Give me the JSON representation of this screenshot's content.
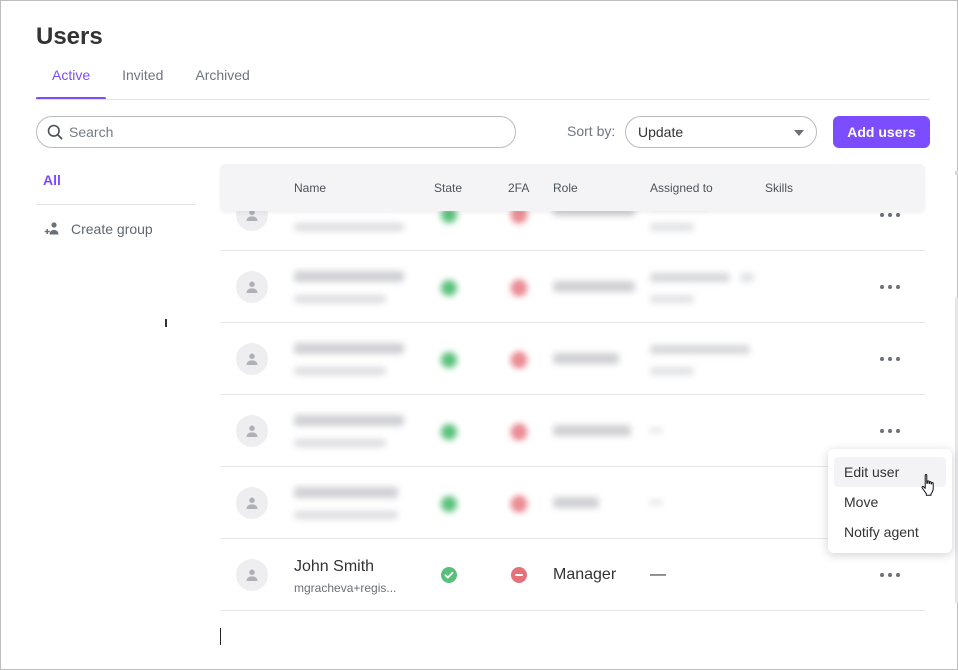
{
  "page": {
    "title": "Users"
  },
  "tabs": [
    {
      "label": "Active",
      "active": true
    },
    {
      "label": "Invited",
      "active": false
    },
    {
      "label": "Archived",
      "active": false
    }
  ],
  "toolbar": {
    "search_placeholder": "Search",
    "sort_label": "Sort by:",
    "sort_value": "Update",
    "add_label": "Add users"
  },
  "sidebar": {
    "all_label": "All",
    "create_group_label": "Create group"
  },
  "table": {
    "columns": [
      "Name",
      "State",
      "2FA",
      "Role",
      "Assigned to",
      "Skills"
    ],
    "rows": [
      {
        "name": "",
        "email": "",
        "role": "",
        "assigned": "",
        "blurred": true
      },
      {
        "name": "",
        "email": "",
        "role": "",
        "assigned": "",
        "blurred": true
      },
      {
        "name": "",
        "email": "",
        "role": "",
        "assigned": "",
        "blurred": true
      },
      {
        "name": "",
        "email": "",
        "role": "",
        "assigned": "",
        "blurred": true
      },
      {
        "name": "",
        "email": "",
        "role": "",
        "assigned": "",
        "blurred": true
      },
      {
        "name": "John Smith",
        "email": "mgracheva+regis...",
        "role": "Manager",
        "assigned": "—",
        "blurred": false
      }
    ]
  },
  "context_menu": {
    "items": [
      "Edit user",
      "Move",
      "Notify agent"
    ]
  },
  "colors": {
    "accent": "#7c4dff",
    "state_active": "#58c07a",
    "twofa_off": "#e5727a"
  }
}
